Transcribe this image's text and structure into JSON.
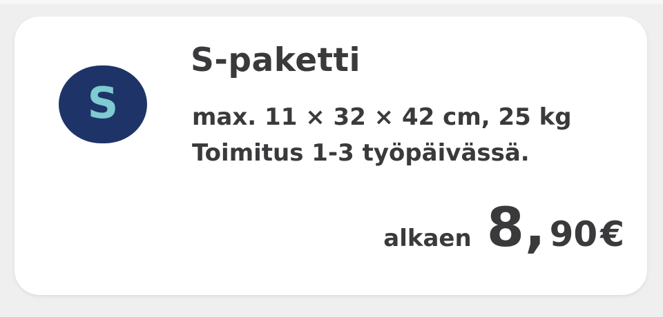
{
  "colors": {
    "text": "#3a3a3c",
    "logo_bg": "#1e3468",
    "logo_letter": "#7ecbd1",
    "card_bg": "#ffffff",
    "page_bg": "#efefef"
  },
  "package": {
    "logo_letter": "S",
    "title": "S-paketti",
    "dimensions": "max. 11 × 32 × 42 cm, 25 kg",
    "delivery": "Toimitus 1-3 työpäivässä.",
    "price": {
      "prefix": "alkaen",
      "integer": "8",
      "separator": ",",
      "decimals": "90",
      "currency": "€"
    }
  }
}
